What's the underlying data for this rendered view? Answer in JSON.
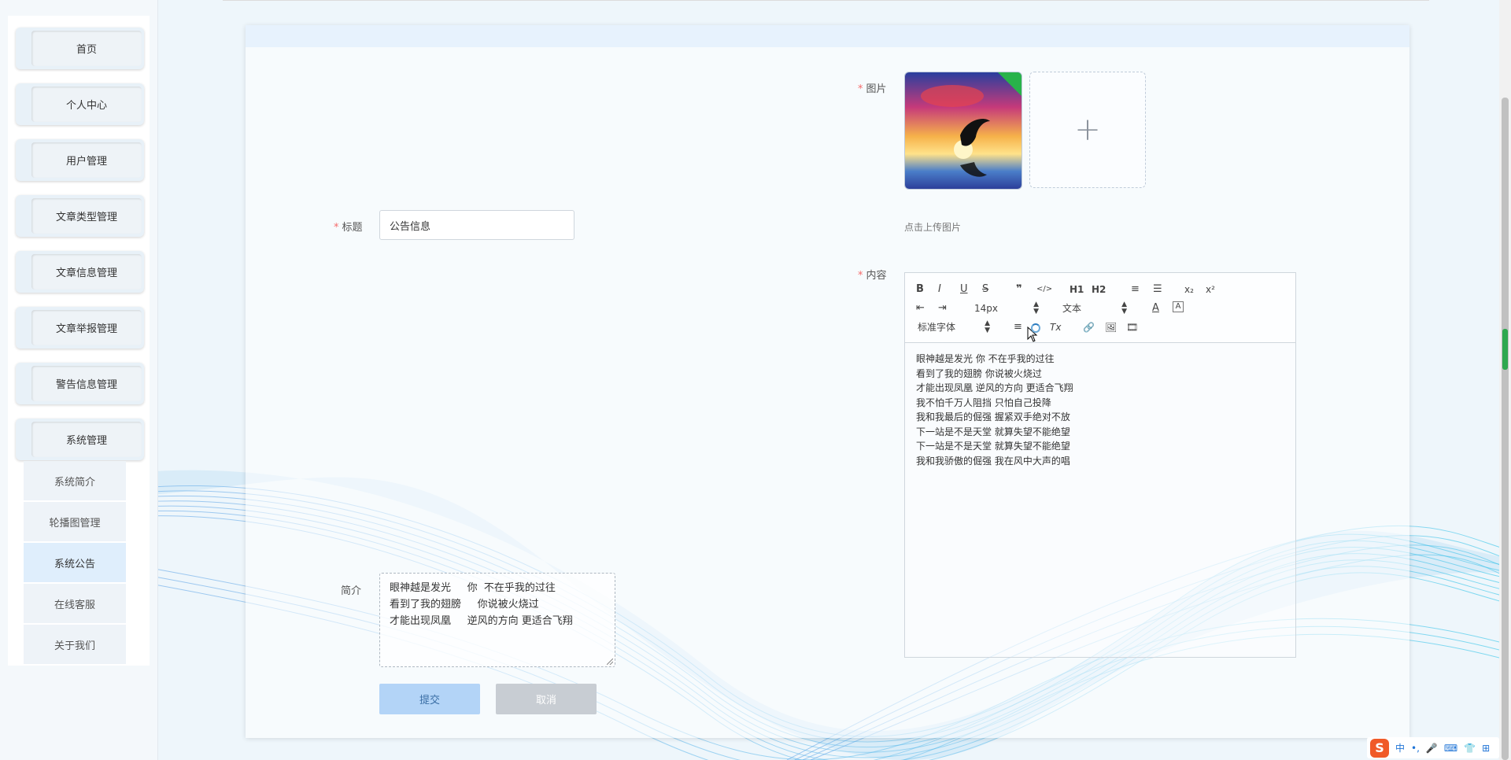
{
  "sidebar": {
    "menu": [
      {
        "label": "首页"
      },
      {
        "label": "个人中心"
      },
      {
        "label": "用户管理"
      },
      {
        "label": "文章类型管理"
      },
      {
        "label": "文章信息管理"
      },
      {
        "label": "文章举报管理"
      },
      {
        "label": "警告信息管理"
      },
      {
        "label": "系统管理"
      }
    ],
    "submenu": [
      {
        "label": "系统简介"
      },
      {
        "label": "轮播图管理"
      },
      {
        "label": "系统公告",
        "active": true
      },
      {
        "label": "在线客服"
      },
      {
        "label": "关于我们"
      }
    ]
  },
  "form": {
    "image_label": "图片",
    "upload_plus": "+",
    "upload_tip": "点击上传图片",
    "title_label": "标题",
    "title_value": "公告信息",
    "content_label": "内容",
    "summary_label": "简介",
    "summary_lines": [
      "眼神越是发光     你  不在乎我的过往",
      "看到了我的翅膀     你说被火烧过",
      "才能出现凤凰     逆风的方向 更适合飞翔"
    ],
    "submit_label": "提交",
    "cancel_label": "取消"
  },
  "editor": {
    "toolbar_row1": [
      {
        "name": "bold-icon",
        "glyph": "B"
      },
      {
        "name": "italic-icon",
        "glyph": "I"
      },
      {
        "name": "underline-icon",
        "glyph": "U"
      },
      {
        "name": "strikethrough-icon",
        "glyph": "S"
      },
      {
        "name": "blockquote-icon",
        "glyph": "❞"
      },
      {
        "name": "code-block-icon",
        "glyph": "</>"
      },
      {
        "name": "header1-icon",
        "glyph": "H1"
      },
      {
        "name": "header2-icon",
        "glyph": "H2"
      },
      {
        "name": "ordered-list-icon",
        "glyph": "≡"
      },
      {
        "name": "bullet-list-icon",
        "glyph": "☰"
      },
      {
        "name": "subscript-icon",
        "glyph": "x₂"
      },
      {
        "name": "superscript-icon",
        "glyph": "x²"
      }
    ],
    "toolbar_row2": {
      "indent_out_glyph": "⇤",
      "indent_in_glyph": "⇥",
      "size_select": "14px",
      "header_select": "文本",
      "color_glyph": "A",
      "background_glyph": "A"
    },
    "toolbar_row3": {
      "font_select": "标准字体",
      "align_glyph": "≡",
      "clean_glyph": "Tx",
      "link_glyph": "🔗",
      "image_glyph": "🖼",
      "video_glyph": "🎞"
    },
    "content_lines": [
      "眼神越是发光 你 不在乎我的过往",
      "看到了我的翅膀 你说被火烧过",
      "才能出现凤凰 逆风的方向 更适合飞翔",
      "我不怕千万人阻挡 只怕自己投降",
      "我和我最后的倔强 握紧双手绝对不放",
      "下一站是不是天堂 就算失望不能绝望",
      "下一站是不是天堂 就算失望不能绝望",
      "我和我骄傲的倔强 我在风中大声的唱"
    ]
  },
  "ime": {
    "logo": "S",
    "items": [
      "中",
      "•,",
      "🎤",
      "⌨",
      "👕",
      "⊞"
    ]
  }
}
